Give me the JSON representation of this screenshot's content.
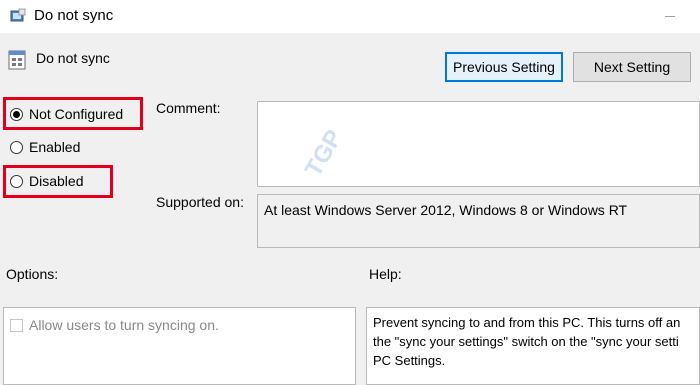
{
  "window": {
    "title": "Do not sync"
  },
  "header": {
    "title": "Do not sync"
  },
  "buttons": {
    "previous": "Previous Setting",
    "next": "Next Setting"
  },
  "state": {
    "options": [
      "Not Configured",
      "Enabled",
      "Disabled"
    ],
    "selected": "Not Configured",
    "highlighted": [
      "Not Configured",
      "Disabled"
    ],
    "highlight_color": "#e0001b"
  },
  "labels": {
    "comment": "Comment:",
    "supported_on": "Supported on:",
    "options": "Options:",
    "help": "Help:"
  },
  "supported_on": "At least Windows Server 2012, Windows 8 or Windows RT",
  "options_panel": {
    "checkbox_label": "Allow users to turn syncing on.",
    "checked": false,
    "enabled": false
  },
  "help_text": [
    "Prevent syncing to and from this PC.  This turns off an",
    "the \"sync your settings\" switch on the \"sync your setti",
    "PC Settings."
  ],
  "watermark": "TGP",
  "colors": {
    "accent": "#0078d7"
  }
}
